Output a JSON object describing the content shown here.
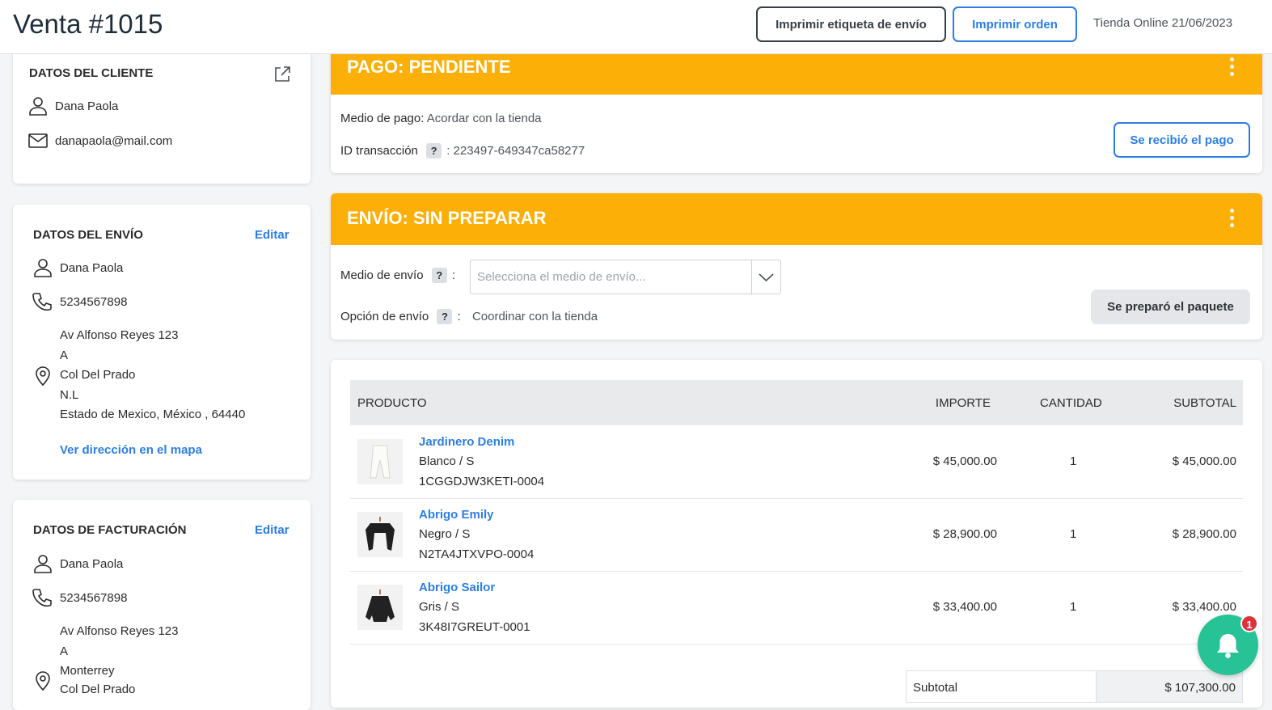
{
  "header": {
    "title": "Venta #1015",
    "print_label_button": "Imprimir etiqueta de envío",
    "print_order_button": "Imprimir orden",
    "store_date": "Tienda Online 21/06/2023"
  },
  "customer": {
    "title": "DATOS DEL CLIENTE",
    "name": "Dana Paola",
    "email": "danapaola@mail.com",
    "icons": [
      "external-link-icon",
      "user-icon",
      "mail-icon"
    ]
  },
  "shipping_data": {
    "title": "DATOS DEL ENVÍO",
    "edit": "Editar",
    "name": "Dana Paola",
    "phone": "5234567898",
    "address": [
      "Av Alfonso Reyes 123",
      "A",
      "Col Del Prado",
      "N.L",
      "Estado de Mexico, México , 64440"
    ],
    "map_link": "Ver dirección en el mapa"
  },
  "billing_data": {
    "title": "DATOS DE FACTURACIÓN",
    "edit": "Editar",
    "name": "Dana Paola",
    "phone": "5234567898",
    "address": [
      "Av Alfonso Reyes 123",
      "A",
      "Monterrey",
      "Col Del Prado"
    ]
  },
  "payment": {
    "title": "PAGO: PENDIENTE",
    "method_label": "Medio de pago:",
    "method_value": "Acordar con la tienda",
    "transaction_label": "ID transacción",
    "help": "?",
    "transaction_value": ": 223497-649347ca58277",
    "received_button": "Se recibió el pago",
    "banner_color": "#fcaf06"
  },
  "shipping": {
    "title": "ENVÍO: SIN PREPARAR",
    "method_label": "Medio de envío",
    "help": "?",
    "colon": ":",
    "select_placeholder": "Selecciona el medio de envío...",
    "option_label": "Opción de envío",
    "option_value": "Coordinar con la tienda",
    "prepared_button": "Se preparó el paquete"
  },
  "products": {
    "headers": {
      "product": "PRODUCTO",
      "amount": "IMPORTE",
      "quantity": "CANTIDAD",
      "subtotal": "SUBTOTAL"
    },
    "rows": [
      {
        "name": "Jardinero Denim",
        "variant": "Blanco / S",
        "sku": "1CGGDJW3KETI-0004",
        "amount": "$ 45,000.00",
        "qty": "1",
        "subtotal": "$ 45,000.00"
      },
      {
        "name": "Abrigo Emily",
        "variant": "Negro / S",
        "sku": "N2TA4JTXVPO-0004",
        "amount": "$ 28,900.00",
        "qty": "1",
        "subtotal": "$ 28,900.00"
      },
      {
        "name": "Abrigo Sailor",
        "variant": "Gris / S",
        "sku": "3K48I7GREUT-0001",
        "amount": "$ 33,400.00",
        "qty": "1",
        "subtotal": "$ 33,400.00"
      }
    ],
    "subtotal_label": "Subtotal",
    "subtotal_value": "$ 107,300.00"
  },
  "notifications": {
    "count": "1",
    "color": "#27c396"
  }
}
